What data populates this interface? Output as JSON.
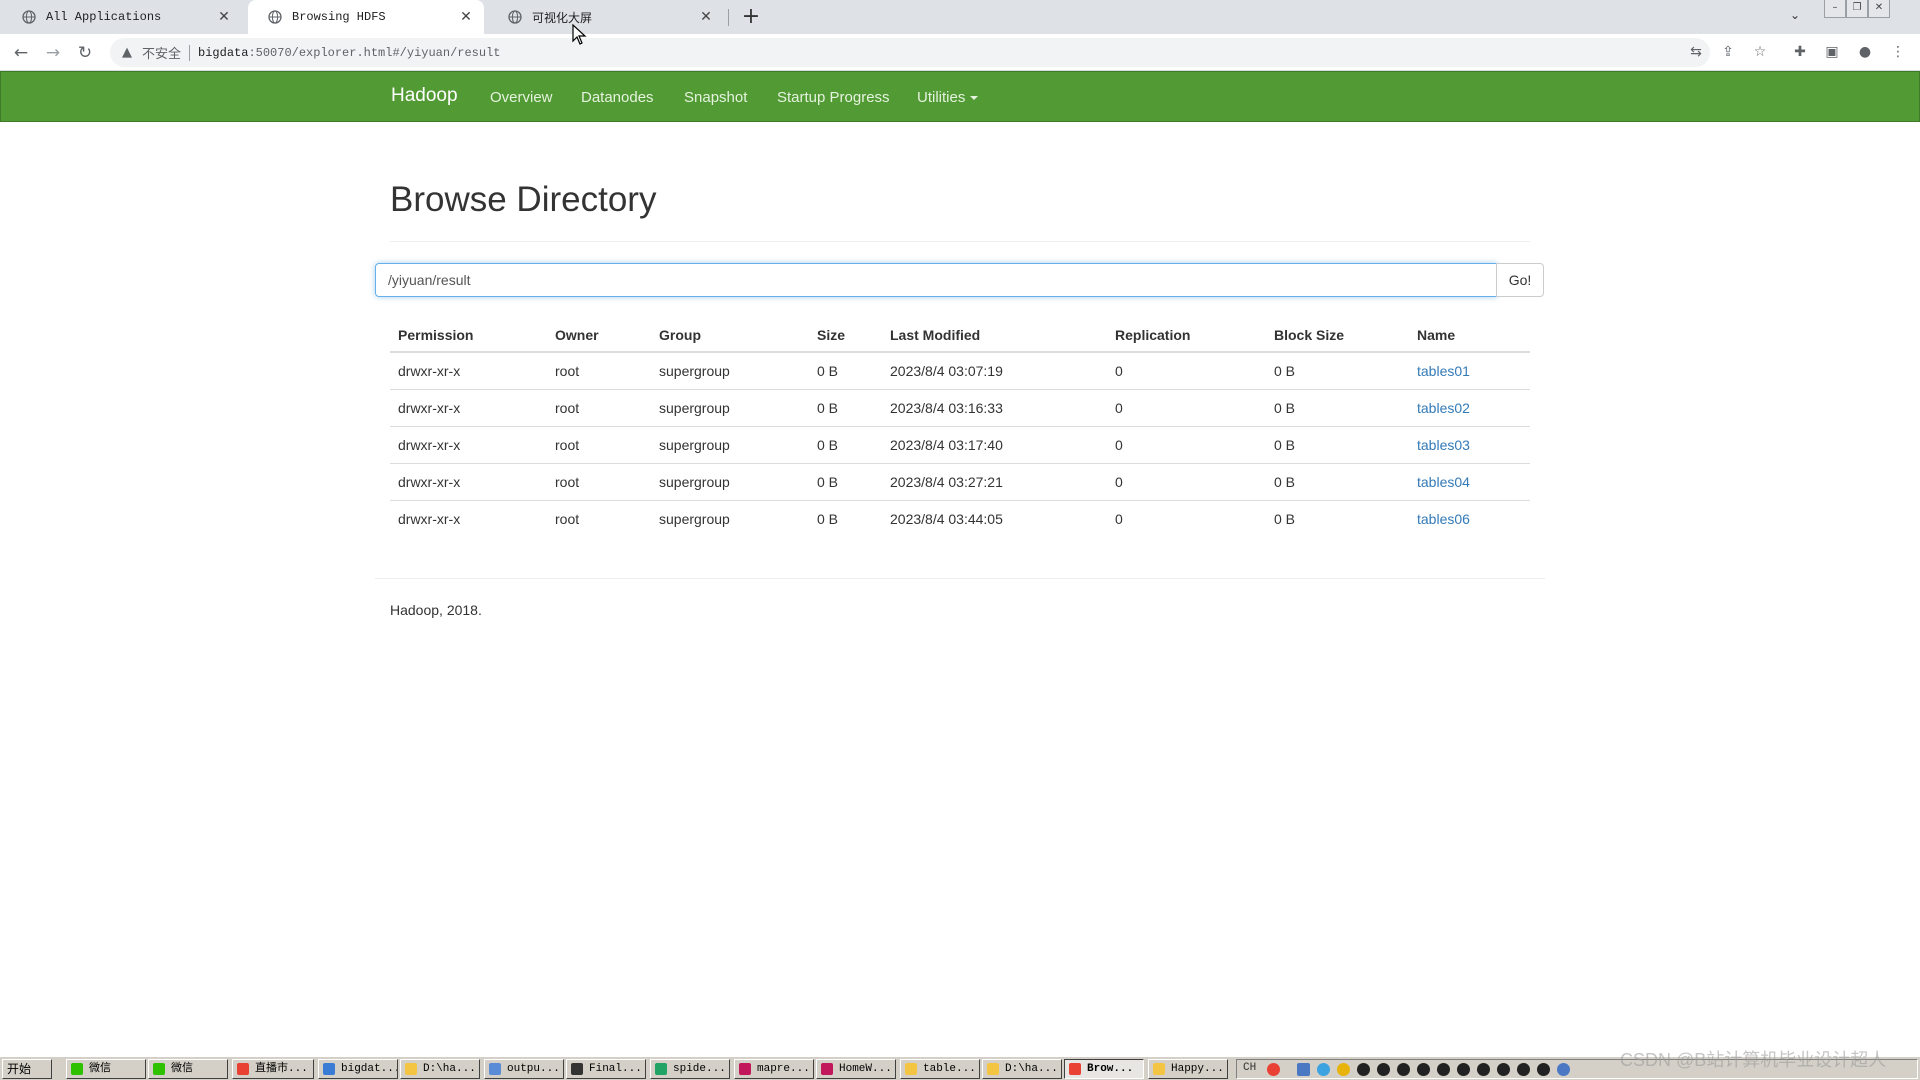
{
  "browser": {
    "tabs": [
      {
        "label": "All Applications",
        "active": false
      },
      {
        "label": "Browsing HDFS",
        "active": true
      },
      {
        "label": "可视化大屏",
        "active": false
      }
    ],
    "address": {
      "security_label": "不安全",
      "host": "bigdata",
      "path": ":50070/explorer.html#/yiyuan/result"
    }
  },
  "navbar": {
    "brand": "Hadoop",
    "links": [
      "Overview",
      "Datanodes",
      "Snapshot",
      "Startup Progress",
      "Utilities"
    ],
    "color": "#529a33"
  },
  "page": {
    "title": "Browse Directory",
    "path_value": "/yiyuan/result",
    "go_label": "Go!",
    "table": {
      "columns": [
        "Permission",
        "Owner",
        "Group",
        "Size",
        "Last Modified",
        "Replication",
        "Block Size",
        "Name"
      ],
      "rows": [
        [
          "drwxr-xr-x",
          "root",
          "supergroup",
          "0 B",
          "2023/8/4 03:07:19",
          "0",
          "0 B",
          "tables01"
        ],
        [
          "drwxr-xr-x",
          "root",
          "supergroup",
          "0 B",
          "2023/8/4 03:16:33",
          "0",
          "0 B",
          "tables02"
        ],
        [
          "drwxr-xr-x",
          "root",
          "supergroup",
          "0 B",
          "2023/8/4 03:17:40",
          "0",
          "0 B",
          "tables03"
        ],
        [
          "drwxr-xr-x",
          "root",
          "supergroup",
          "0 B",
          "2023/8/4 03:27:21",
          "0",
          "0 B",
          "tables04"
        ],
        [
          "drwxr-xr-x",
          "root",
          "supergroup",
          "0 B",
          "2023/8/4 03:44:05",
          "0",
          "0 B",
          "tables06"
        ]
      ]
    },
    "footer": "Hadoop, 2018."
  },
  "taskbar": {
    "start_label": "开始",
    "items": [
      {
        "label": "微信",
        "icon_color": "#2dc100"
      },
      {
        "label": "微信",
        "icon_color": "#2dc100"
      },
      {
        "label": "直播市...",
        "icon_color": "#e94235"
      },
      {
        "label": "bigdat...",
        "icon_color": "#3a7bd5"
      },
      {
        "label": "D:\\ha...",
        "icon_color": "#f4c542"
      },
      {
        "label": "outpu...",
        "icon_color": "#5a8bd6"
      },
      {
        "label": "Final...",
        "icon_color": "#333333"
      },
      {
        "label": "spide...",
        "icon_color": "#21a366"
      },
      {
        "label": "mapre...",
        "icon_color": "#c2185b"
      },
      {
        "label": "HomeW...",
        "icon_color": "#c2185b"
      },
      {
        "label": "table...",
        "icon_color": "#f4c542"
      },
      {
        "label": "D:\\ha...",
        "icon_color": "#f4c542"
      },
      {
        "label": "Brow...",
        "icon_color": "#e94235"
      },
      {
        "label": "Happy...",
        "icon_color": "#f4c542"
      }
    ],
    "tray_lang": "CH"
  },
  "watermark": "CSDN @B站计算机毕业设计超人"
}
